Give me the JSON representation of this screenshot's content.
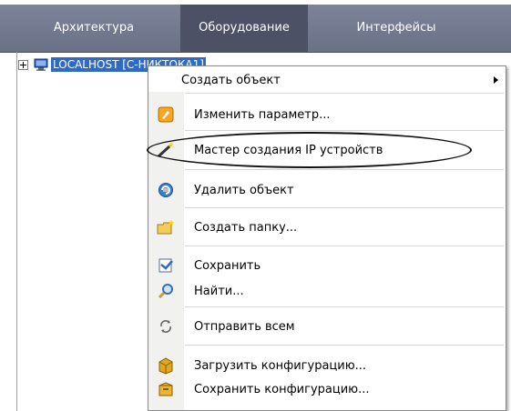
{
  "tabs": [
    {
      "label": "Архитектура",
      "active": false
    },
    {
      "label": "Оборудование",
      "active": true
    },
    {
      "label": "Интерфейсы",
      "active": false
    }
  ],
  "top_crop_text": "",
  "tree": {
    "node_label": "LOCALHOST [С-НИКТОКА1]"
  },
  "context_menu": {
    "create_object": "Создать объект",
    "items": [
      {
        "label": "Изменить параметр...",
        "icon": "edit-param-icon"
      },
      {
        "label": "Мастер создания IP устройств",
        "icon": "wizard-wand-icon"
      },
      {
        "label": "Удалить объект",
        "icon": "delete-object-icon"
      },
      {
        "label": "Создать папку...",
        "icon": "new-folder-icon"
      },
      {
        "label": "Сохранить",
        "icon": "save-icon"
      },
      {
        "label": "Найти...",
        "icon": "search-icon"
      },
      {
        "label": "Отправить всем",
        "icon": "send-all-icon"
      },
      {
        "label": "Загрузить конфигурацию...",
        "icon": "load-config-icon"
      },
      {
        "label": "Сохранить конфигурацию...",
        "icon": "save-config-icon"
      }
    ]
  },
  "colors": {
    "tab_bg": "#6a7186",
    "tab_active": "#4c5166",
    "selection": "#316ac5"
  }
}
